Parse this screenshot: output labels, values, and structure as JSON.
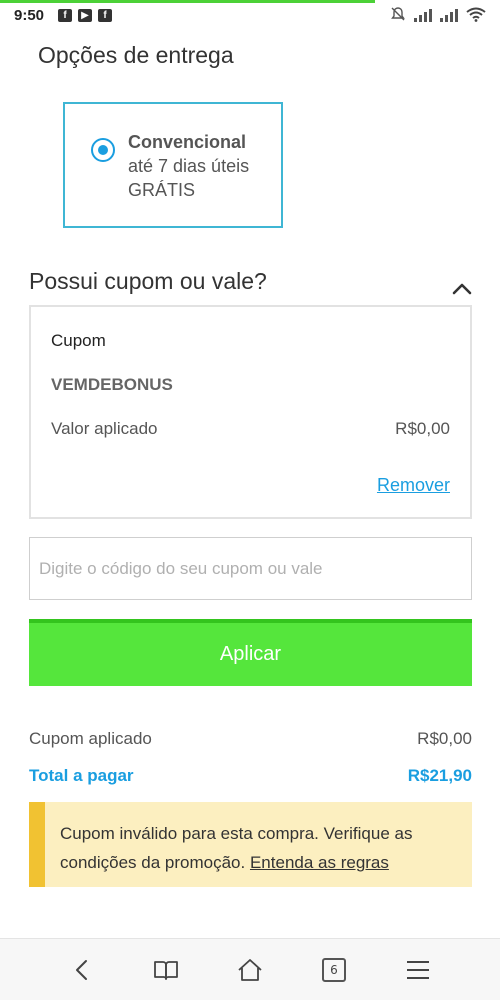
{
  "status_bar": {
    "time": "9:50",
    "left_icons": [
      "facebook-icon",
      "youtube-icon",
      "facebook-icon"
    ],
    "right_icons": [
      "bell-muted-icon",
      "signal-icon",
      "signal-icon",
      "wifi-icon"
    ]
  },
  "delivery": {
    "title": "Opções de entrega",
    "option": {
      "name": "Convencional",
      "time": "até 7 dias úteis",
      "price": "GRÁTIS",
      "selected": true
    }
  },
  "coupon": {
    "title": "Possui cupom ou vale?",
    "box": {
      "label": "Cupom",
      "code": "VEMDEBONUS",
      "applied_label": "Valor aplicado",
      "applied_value": "R$0,00",
      "remove_label": "Remover"
    },
    "input_placeholder": "Digite o código do seu cupom ou vale",
    "apply_label": "Aplicar"
  },
  "totals": {
    "coupon_label": "Cupom aplicado",
    "coupon_value": "R$0,00",
    "total_label": "Total a pagar",
    "total_value": "R$21,90"
  },
  "warning": {
    "text": "Cupom inválido para esta compra. Verifique as condições da promoção.",
    "link": "Entenda as regras"
  },
  "bottom_nav": {
    "tabs_count": "6",
    "icons": [
      "back-icon",
      "bookmarks-icon",
      "home-icon",
      "tabs-icon",
      "menu-icon"
    ]
  },
  "colors": {
    "accent_blue": "#1a9ee0",
    "card_border": "#3fb6d4",
    "apply_green": "#55e63c",
    "warning_bg": "#fcefc0",
    "warning_bar": "#f1c232"
  }
}
